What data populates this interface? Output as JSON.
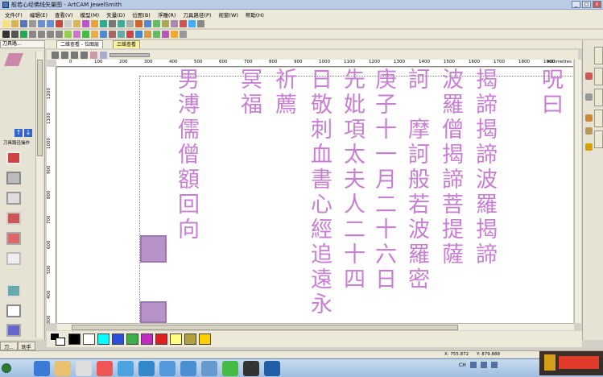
{
  "window": {
    "title": "般若心经佛线矢量图 - ArtCAM JewelSmith"
  },
  "menu": [
    "文件(F)",
    "编辑(E)",
    "查看(V)",
    "模型(M)",
    "矢量(D)",
    "位图(B)",
    "浮雕(R)",
    "刀具路径(P)",
    "视窗(W)",
    "帮助(H)"
  ],
  "tabs": {
    "panel": "刀具路...",
    "active_doc": "二维查看 - 位图层",
    "other_doc": "三维查看"
  },
  "left_panel": {
    "label": "刀具路径操作"
  },
  "left_tabs": [
    "刀...",
    "助手"
  ],
  "ruler_top": [
    "0",
    "100",
    "200",
    "300",
    "400",
    "500",
    "600",
    "700",
    "800",
    "900",
    "1000",
    "1100",
    "1200",
    "1300",
    "1400",
    "1500",
    "1600",
    "1700",
    "1800",
    "1900"
  ],
  "ruler_left": [
    "1200",
    "1100",
    "1000",
    "900",
    "800",
    "700",
    "600",
    "500",
    "400",
    "300"
  ],
  "ruler_unit": "millimetres",
  "columns": [
    {
      "id": "c1",
      "text": "呪曰"
    },
    {
      "id": "c2",
      "text": "揭諦揭諦波羅揭諦"
    },
    {
      "id": "c3",
      "text": "波羅僧揭諦菩提薩"
    },
    {
      "id": "c4",
      "text": "訶 摩訶般若波羅密"
    },
    {
      "id": "c5",
      "text": "庚子十一月二十六日"
    },
    {
      "id": "c6",
      "text": "先妣項太夫人二十四"
    },
    {
      "id": "c7",
      "text": "日敬刺血書心經追遠永"
    },
    {
      "id": "c8",
      "text": "祈薦"
    },
    {
      "id": "c9",
      "text": "冥福"
    },
    {
      "id": "c10",
      "text": "男溥儒僧額回向"
    }
  ],
  "palette": [
    "#000000",
    "#ffffff",
    "#00ffff",
    "#2b4fd6",
    "#3cb04a",
    "#c02bc0",
    "#e02020",
    "#ffff80",
    "#b0a040",
    "#ffd000"
  ],
  "status": {
    "x": "X: 755.872",
    "y": "Y: 879.888"
  },
  "tray": {
    "ime": "CH"
  }
}
